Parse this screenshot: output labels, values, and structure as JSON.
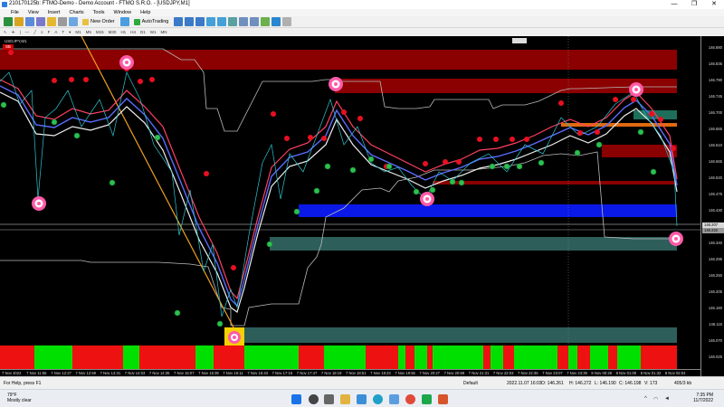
{
  "window": {
    "title": "210170125b: FTMO-Demo - Demo Account - FTMO S.R.O. - [USDJPY,M1]",
    "controls": [
      "—",
      "❐",
      "✕"
    ]
  },
  "menu": [
    "File",
    "View",
    "Insert",
    "Charts",
    "Tools",
    "Window",
    "Help"
  ],
  "toolbar": {
    "new_order": "New Order",
    "autotrading": "AutoTrading"
  },
  "timeframes": [
    "M1",
    "M5",
    "M15",
    "M30",
    "H1",
    "H4",
    "D1",
    "W1",
    "MN"
  ],
  "chart": {
    "symbol_label": "USDJPY,M1",
    "badge": "SB",
    "price_ticks": [
      "146.880",
      "146.835",
      "146.790",
      "146.745",
      "146.700",
      "146.655",
      "146.610",
      "146.565",
      "146.520",
      "146.475",
      "146.430",
      "146.385",
      "146.340",
      "146.295",
      "146.250",
      "146.205",
      "146.160",
      "146.115",
      "146.070",
      "146.025"
    ],
    "current_price": "146.207",
    "ask_price": "146.222",
    "time_labels": [
      "7 Nov 2022",
      "7 Nov 11:55",
      "7 Nov 12:27",
      "7 Nov 12:59",
      "7 Nov 13:31",
      "7 Nov 14:03",
      "7 Nov 14:35",
      "7 Nov 15:07",
      "7 Nov 15:39",
      "7 Nov 16:11",
      "7 Nov 16:43",
      "7 Nov 17:15",
      "7 Nov 17:47",
      "7 Nov 18:19",
      "7 Nov 18:51",
      "7 Nov 19:23",
      "7 Nov 19:55",
      "7 Nov 20:27",
      "7 Nov 20:59",
      "7 Nov 21:31",
      "7 Nov 22:03",
      "7 Nov 22:35",
      "7 Nov 23:07",
      "7 Nov 23:39",
      "8 Nov 00:28",
      "8 Nov 01:00",
      "8 Nov 01:32",
      "8 Nov 02:04"
    ],
    "colors": {
      "background": "#000000",
      "zone_red": "#8b0000",
      "zone_green": "#2e5e5a",
      "zone_blue": "#0a18e8",
      "trendline": "#f0a020",
      "histogram_green": "#00e000",
      "histogram_red": "#ee1111"
    }
  },
  "status": {
    "help": "For Help, press F1",
    "profile": "Default",
    "datetime": "2022.11.07 16:03",
    "open": "O: 146.261",
    "high": "H: 146.272",
    "low": "L: 146.190",
    "close": "C: 146.198",
    "volume": "V: 173",
    "traffic": "405/3 kb"
  },
  "taskbar": {
    "weather_temp": "79°F",
    "weather_text": "Mostly clear",
    "time": "7:35 PM",
    "date": "11/7/2022",
    "icons": [
      "windows-start",
      "search",
      "task-view",
      "explorer",
      "store",
      "edge",
      "mail",
      "chrome",
      "app-green",
      "app-orange"
    ]
  }
}
